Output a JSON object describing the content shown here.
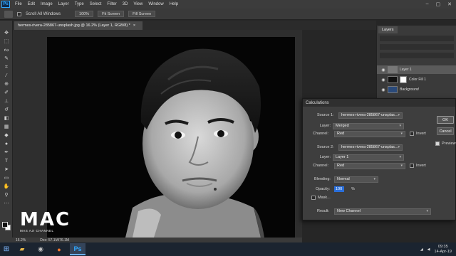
{
  "menubar": {
    "logo": "Ps",
    "items": [
      "File",
      "Edit",
      "Image",
      "Layer",
      "Type",
      "Select",
      "Filter",
      "3D",
      "View",
      "Window",
      "Help"
    ],
    "controls": [
      "–",
      "▢",
      "✕"
    ]
  },
  "options": {
    "scroll_all_windows": "Scroll All Windows",
    "zoom": "100%",
    "fit_screen": "Fit Screen",
    "fill_screen": "Fill Screen"
  },
  "document": {
    "tab_label": "hermes-rivera-285867-unsplash.jpg @ 16.2% (Layer 1, RGB/8) *",
    "tab_close": "×"
  },
  "layers_panel": {
    "tab_label": "Layers",
    "layers": [
      {
        "name": "Layer 1",
        "selected": true
      },
      {
        "name": "Color Fill 1",
        "selected": false
      },
      {
        "name": "Background",
        "selected": false
      }
    ]
  },
  "calculations": {
    "title": "Calculations",
    "source1_label": "Source 1:",
    "source1_value": "hermes-rivera-285867-unsplas...",
    "layer_label": "Layer:",
    "source1_layer": "Merged",
    "channel_label": "Channel:",
    "source1_channel": "Red",
    "invert_label": "Invert",
    "source2_label": "Source 2:",
    "source2_value": "hermes-rivera-285867-unsplas...",
    "source2_layer": "Layer 1",
    "source2_channel": "Red",
    "blending_label": "Blending:",
    "blending_value": "Normal",
    "opacity_label": "Opacity:",
    "opacity_value": "100",
    "opacity_unit": "%",
    "mask_label": "Mask...",
    "result_label": "Result:",
    "result_value": "New Channel",
    "ok_label": "OK",
    "cancel_label": "Cancel",
    "preview_label": "Preview",
    "preview_checked": true
  },
  "watermark": {
    "logo": "MAC",
    "subtitle": "MAS AJI CHANNEL"
  },
  "statusbar": {
    "zoom": "16.2%",
    "doc_info": "Doc: 57.1M/76.1M"
  },
  "taskbar": {
    "time": "09:35",
    "date": "14-Apr-19"
  }
}
